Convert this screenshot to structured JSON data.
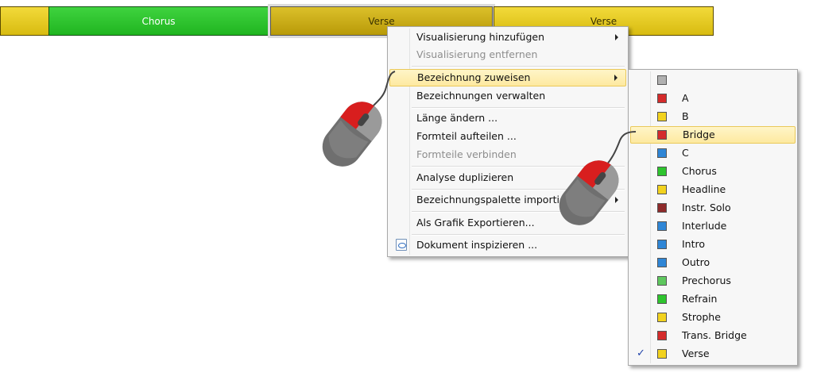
{
  "track": {
    "segments": [
      {
        "label": "",
        "color": "#e6c820"
      },
      {
        "label": "Chorus",
        "color": "#2ec42e"
      },
      {
        "label": "Verse",
        "color": "#c9ad18",
        "selected": true
      },
      {
        "label": "Verse",
        "color": "#e6c820"
      }
    ]
  },
  "context_menu": {
    "items": [
      {
        "label": "Visualisierung hinzufügen",
        "submenu": true
      },
      {
        "label": "Visualisierung entfernen",
        "disabled": true
      },
      {
        "label": "Bezeichnung zuweisen",
        "submenu": true,
        "highlighted": true
      },
      {
        "label": "Bezeichnungen verwalten"
      },
      {
        "label": "Länge ändern ..."
      },
      {
        "label": "Formteil aufteilen ..."
      },
      {
        "label": "Formteile verbinden",
        "disabled": true
      },
      {
        "label": "Analyse duplizieren"
      },
      {
        "label": "Bezeichnungspalette importieren",
        "submenu": true
      },
      {
        "label": "Als Grafik Exportieren..."
      },
      {
        "label": "Dokument inspizieren ...",
        "icon": "document-inspect-icon"
      }
    ]
  },
  "label_submenu": {
    "items": [
      {
        "label": "",
        "color": "#b0b0b0"
      },
      {
        "label": "A",
        "color": "#d42b2b"
      },
      {
        "label": "B",
        "color": "#f2d21e"
      },
      {
        "label": "Bridge",
        "color": "#d42b2b",
        "highlighted": true
      },
      {
        "label": "C",
        "color": "#2f86d6"
      },
      {
        "label": "Chorus",
        "color": "#2ec42e"
      },
      {
        "label": "Headline",
        "color": "#f2d21e"
      },
      {
        "label": "Instr. Solo",
        "color": "#8e2a2a"
      },
      {
        "label": "Interlude",
        "color": "#2f86d6"
      },
      {
        "label": "Intro",
        "color": "#2f86d6"
      },
      {
        "label": "Outro",
        "color": "#2f86d6"
      },
      {
        "label": "Prechorus",
        "color": "#5ec75e"
      },
      {
        "label": "Refrain",
        "color": "#2ec42e"
      },
      {
        "label": "Strophe",
        "color": "#f2d21e"
      },
      {
        "label": "Trans. Bridge",
        "color": "#d42b2b"
      },
      {
        "label": "Verse",
        "color": "#f2d21e",
        "checked": true
      }
    ],
    "check_glyph": "✓"
  },
  "icons": [
    "mouse-icon",
    "submenu-arrow-icon",
    "checkmark-icon",
    "document-inspect-icon"
  ]
}
